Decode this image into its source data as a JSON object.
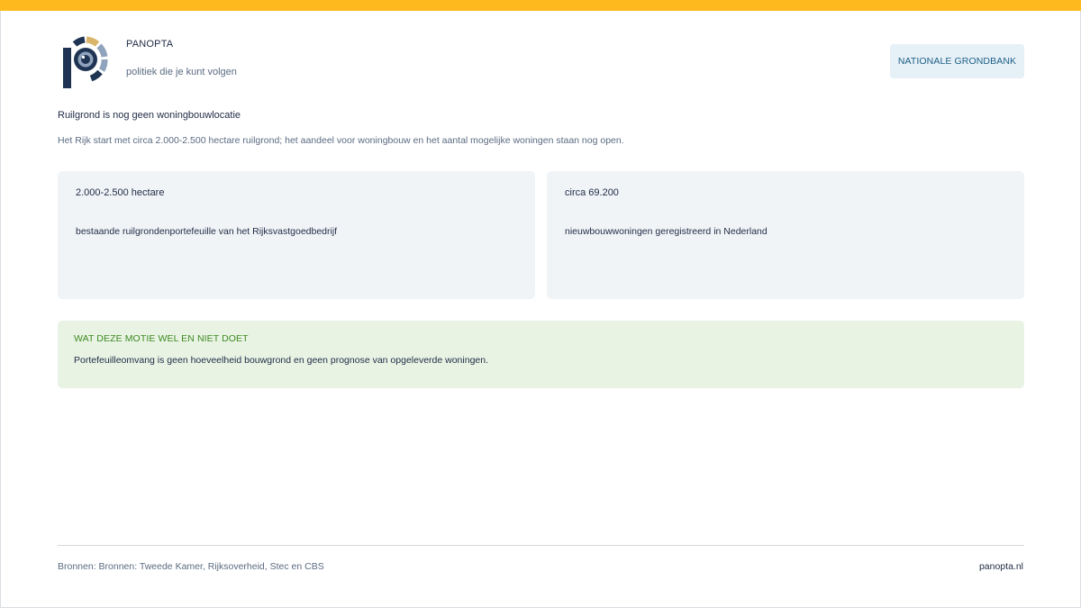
{
  "brand": {
    "name": "PANOPTA",
    "tagline": "politiek die je kunt volgen",
    "logo_icon": "eye-logo-icon",
    "colors": {
      "navy": "#1f3352",
      "gold": "#d9b56b",
      "steel": "#8fa3bd",
      "accent": "#fdb91d"
    }
  },
  "topic_tag": "NATIONALE GRONDBANK",
  "headline": "Ruilgrond is nog geen woningbouwlocatie",
  "subline": "Het Rijk start met circa 2.000-2.500 hectare ruilgrond; het aandeel voor woningbouw en het aantal mogelijke woningen staan nog open.",
  "stats": [
    {
      "value": "2.000-2.500 hectare",
      "label": "bestaande ruilgrondenportefeuille van het Rijksvastgoedbedrijf"
    },
    {
      "value": "circa 69.200",
      "label": "nieuwbouwwoningen geregistreerd in Nederland"
    }
  ],
  "note": {
    "title": "WAT DEZE MOTIE WEL EN NIET DOET",
    "body": "Portefeuilleomvang is geen hoeveelheid bouwgrond en geen prognose van opgeleverde woningen."
  },
  "footer": {
    "sources": "Bronnen: Bronnen: Tweede Kamer, Rijksoverheid, Stec en CBS",
    "site": "panopta.nl"
  }
}
